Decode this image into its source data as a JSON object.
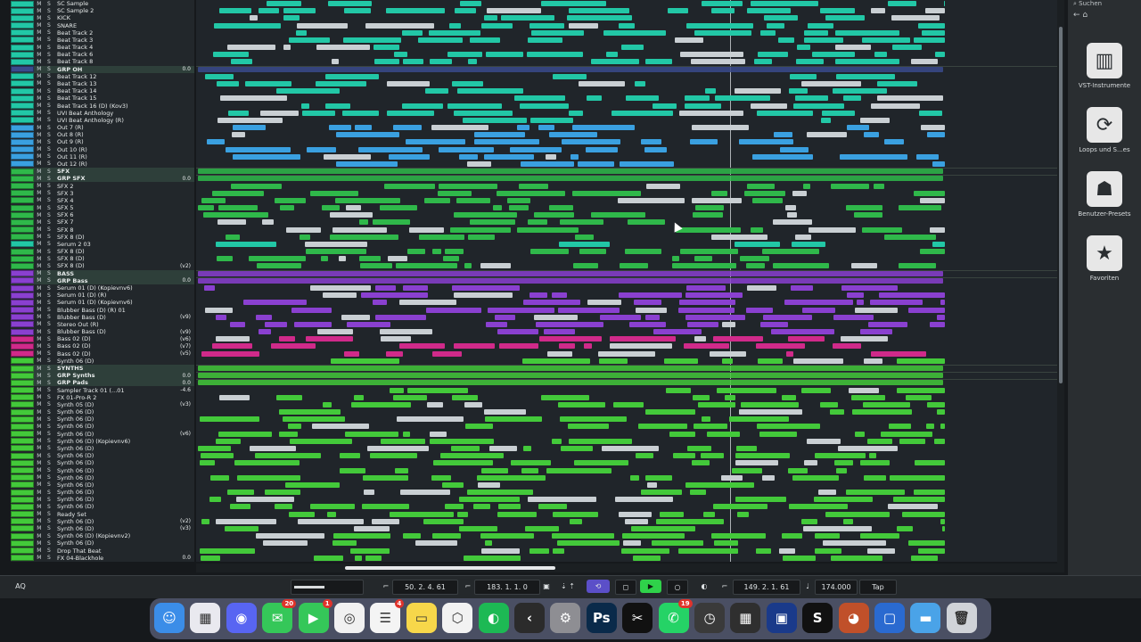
{
  "tracks": [
    {
      "name": "SC Sample",
      "color": "#22c7a6"
    },
    {
      "name": "SC Sample 2",
      "color": "#22c7a6"
    },
    {
      "name": "KICK",
      "color": "#22c7a6"
    },
    {
      "name": "SNARE",
      "color": "#22c7a6"
    },
    {
      "name": "Beat Track 2",
      "color": "#22c7a6"
    },
    {
      "name": "Beat Track 3",
      "color": "#22c7a6"
    },
    {
      "name": "Beat Track 4",
      "color": "#22c7a6"
    },
    {
      "name": "Beat Track 6",
      "color": "#22c7a6"
    },
    {
      "name": "Beat Track 8",
      "color": "#22c7a6"
    },
    {
      "name": "GRP OH",
      "color": "#3a4a8c",
      "suffix": "0.0",
      "folder": true
    },
    {
      "name": "Beat Track 12",
      "color": "#22c7a6"
    },
    {
      "name": "Beat Track 13",
      "color": "#22c7a6"
    },
    {
      "name": "Beat Track 14",
      "color": "#22c7a6"
    },
    {
      "name": "Beat Track 15",
      "color": "#22c7a6"
    },
    {
      "name": "Beat Track 16 (D) (Kov3)",
      "color": "#22c7a6"
    },
    {
      "name": "UVI Beat Anthology",
      "color": "#22c7a6"
    },
    {
      "name": "UVI Beat Anthology (R)",
      "color": "#22c7a6"
    },
    {
      "name": "Out 7 (R)",
      "color": "#3aa0e0"
    },
    {
      "name": "Out 8 (R)",
      "color": "#3aa0e0"
    },
    {
      "name": "Out 9 (R)",
      "color": "#3aa0e0"
    },
    {
      "name": "Out 10 (R)",
      "color": "#3aa0e0"
    },
    {
      "name": "Out 11 (R)",
      "color": "#3aa0e0"
    },
    {
      "name": "Out 12 (R)",
      "color": "#3aa0e0"
    },
    {
      "name": "SFX",
      "color": "#2fb84a",
      "folder": true
    },
    {
      "name": "GRP SFX",
      "color": "#2fb84a",
      "suffix": "0.0",
      "folder": true
    },
    {
      "name": "SFX 2",
      "color": "#2fb84a"
    },
    {
      "name": "SFX 3",
      "color": "#2fb84a"
    },
    {
      "name": "SFX 4",
      "color": "#2fb84a"
    },
    {
      "name": "SFX 5",
      "color": "#2fb84a"
    },
    {
      "name": "SFX 6",
      "color": "#2fb84a"
    },
    {
      "name": "SFX 7",
      "color": "#2fb84a"
    },
    {
      "name": "SFX 8",
      "color": "#2fb84a"
    },
    {
      "name": "SFX 8 (D)",
      "color": "#2fb84a"
    },
    {
      "name": "Serum 2 03",
      "color": "#22c7a6"
    },
    {
      "name": "SFX 8 (D)",
      "color": "#2fb84a"
    },
    {
      "name": "SFX 8 (D)",
      "color": "#2fb84a"
    },
    {
      "name": "SFX 8 (D)",
      "color": "#2fb84a",
      "suffix": "(v2)"
    },
    {
      "name": "BASS",
      "color": "#8a40d0",
      "folder": true
    },
    {
      "name": "GRP Bass",
      "color": "#8a40d0",
      "suffix": "0.0",
      "folder": true
    },
    {
      "name": "Serum 01 (D) (Kopievnv6)",
      "color": "#8a40d0"
    },
    {
      "name": "Serum 01 (D) (R)",
      "color": "#8a40d0"
    },
    {
      "name": "Serum 01 (D) (Kopievnv6)",
      "color": "#8a40d0"
    },
    {
      "name": "Blubber Bass (D) (R) 01",
      "color": "#8a40d0"
    },
    {
      "name": "Blubber Bass (D)",
      "color": "#8a40d0",
      "suffix": "(v9)"
    },
    {
      "name": "Stereo Out (R)",
      "color": "#8a40d0"
    },
    {
      "name": "Blubber Bass (D)",
      "color": "#8a40d0",
      "suffix": "(v9)"
    },
    {
      "name": "Bass 02 (D)",
      "color": "#d02a8a",
      "suffix": "(v6)"
    },
    {
      "name": "Bass 02 (D)",
      "color": "#d02a8a",
      "suffix": "(v7)"
    },
    {
      "name": "Bass 02 (D)",
      "color": "#d02a8a",
      "suffix": "(v5)"
    },
    {
      "name": "Synth 06 (D)",
      "color": "#43c93a"
    },
    {
      "name": "SYNTHS",
      "color": "#43c93a",
      "folder": true
    },
    {
      "name": "GRP Synths",
      "color": "#43c93a",
      "suffix": "0.0",
      "folder": true
    },
    {
      "name": "GRP Pads",
      "color": "#43c93a",
      "suffix": "0.0",
      "folder": true
    },
    {
      "name": "Sampler Track 01 (...01",
      "color": "#43c93a",
      "suffix": "-4.6"
    },
    {
      "name": "FX 01-Pro-R 2",
      "color": "#43c93a"
    },
    {
      "name": "Synth 05 (D)",
      "color": "#43c93a",
      "suffix": "(v3)"
    },
    {
      "name": "Synth 06 (D)",
      "color": "#43c93a"
    },
    {
      "name": "Synth 06 (D)",
      "color": "#43c93a"
    },
    {
      "name": "Synth 06 (D)",
      "color": "#43c93a"
    },
    {
      "name": "Synth 06 (D)",
      "color": "#43c93a",
      "suffix": "(v6)"
    },
    {
      "name": "Synth 06 (D) (Kopievnv6)",
      "color": "#43c93a"
    },
    {
      "name": "Synth 06 (D)",
      "color": "#43c93a"
    },
    {
      "name": "Synth 06 (D)",
      "color": "#43c93a"
    },
    {
      "name": "Synth 06 (D)",
      "color": "#43c93a"
    },
    {
      "name": "Synth 06 (D)",
      "color": "#43c93a"
    },
    {
      "name": "Synth 06 (D)",
      "color": "#43c93a"
    },
    {
      "name": "Synth 06 (D)",
      "color": "#43c93a"
    },
    {
      "name": "Synth 06 (D)",
      "color": "#43c93a"
    },
    {
      "name": "Synth 06 (D)",
      "color": "#43c93a"
    },
    {
      "name": "Synth 06 (D)",
      "color": "#43c93a"
    },
    {
      "name": "Ready Set",
      "color": "#43c93a"
    },
    {
      "name": "Synth 06 (D)",
      "color": "#43c93a",
      "suffix": "(v2)"
    },
    {
      "name": "Synth 06 (D)",
      "color": "#43c93a",
      "suffix": "(v3)"
    },
    {
      "name": "Synth 06 (D) (Kopievnv2)",
      "color": "#43c93a"
    },
    {
      "name": "Synth 06 (D)",
      "color": "#43c93a"
    },
    {
      "name": "Drop That Beat",
      "color": "#43c93a"
    },
    {
      "name": "FX 04-Blackhole",
      "color": "#43c93a",
      "suffix": "0.0"
    }
  ],
  "track_buttons": {
    "mute": "M",
    "solo": "S"
  },
  "right_zone": {
    "search_label": "Suchen",
    "items": [
      {
        "label": "VST-Instrumente",
        "icon": "piano-icon",
        "glyph": "▥"
      },
      {
        "label": "Loops und S...es",
        "icon": "loop-icon",
        "glyph": "⟳"
      },
      {
        "label": "Benutzer-Presets",
        "icon": "presets-icon",
        "glyph": "☗"
      },
      {
        "label": "Favoriten",
        "icon": "star-icon",
        "glyph": "★"
      }
    ]
  },
  "transport": {
    "left_label": "AQ",
    "left_locator": "50. 2. 4. 61",
    "right_locator": "183. 1. 1. 0",
    "position": "149. 2. 1. 61",
    "tempo": "174.000",
    "tap_label": "Tap"
  },
  "dock": [
    {
      "name": "finder",
      "color": "#3b8de8",
      "glyph": "☺"
    },
    {
      "name": "launchpad",
      "color": "#e9e9ef",
      "glyph": "▦"
    },
    {
      "name": "discord",
      "color": "#5865f2",
      "glyph": "◉"
    },
    {
      "name": "messages",
      "color": "#35c759",
      "glyph": "✉",
      "badge": "20"
    },
    {
      "name": "facetime",
      "color": "#35c759",
      "glyph": "▶",
      "badge": "1"
    },
    {
      "name": "chrome",
      "color": "#f1f1f1",
      "glyph": "◎"
    },
    {
      "name": "reminders",
      "color": "#f4f4f4",
      "glyph": "☰",
      "badge": "4"
    },
    {
      "name": "notes",
      "color": "#f7d74a",
      "glyph": "▭"
    },
    {
      "name": "unity",
      "color": "#f2f2f2",
      "glyph": "⬡"
    },
    {
      "name": "spotify",
      "color": "#1db954",
      "glyph": "◐"
    },
    {
      "name": "capcut",
      "color": "#2b2b2b",
      "glyph": "‹"
    },
    {
      "name": "system-settings",
      "color": "#8e8e93",
      "glyph": "⚙"
    },
    {
      "name": "photoshop",
      "color": "#0a2a4a",
      "glyph": "Ps"
    },
    {
      "name": "capcut-2",
      "color": "#111111",
      "glyph": "✂"
    },
    {
      "name": "whatsapp",
      "color": "#25d366",
      "glyph": "✆",
      "badge": "19"
    },
    {
      "name": "activity",
      "color": "#3a3a3a",
      "glyph": "◷"
    },
    {
      "name": "calculator",
      "color": "#2f2f2f",
      "glyph": "▦"
    },
    {
      "name": "cubase",
      "color": "#1a3a8a",
      "glyph": "▣"
    },
    {
      "name": "serato",
      "color": "#111111",
      "glyph": "S"
    },
    {
      "name": "fl-studio",
      "color": "#c0502a",
      "glyph": "◕"
    },
    {
      "name": "preview",
      "color": "#2a6ad0",
      "glyph": "▢"
    },
    {
      "name": "downloads-folder",
      "color": "#4aa3e8",
      "glyph": "▬"
    },
    {
      "name": "trash",
      "color": "#d0d3d8",
      "glyph": "🗑"
    }
  ]
}
